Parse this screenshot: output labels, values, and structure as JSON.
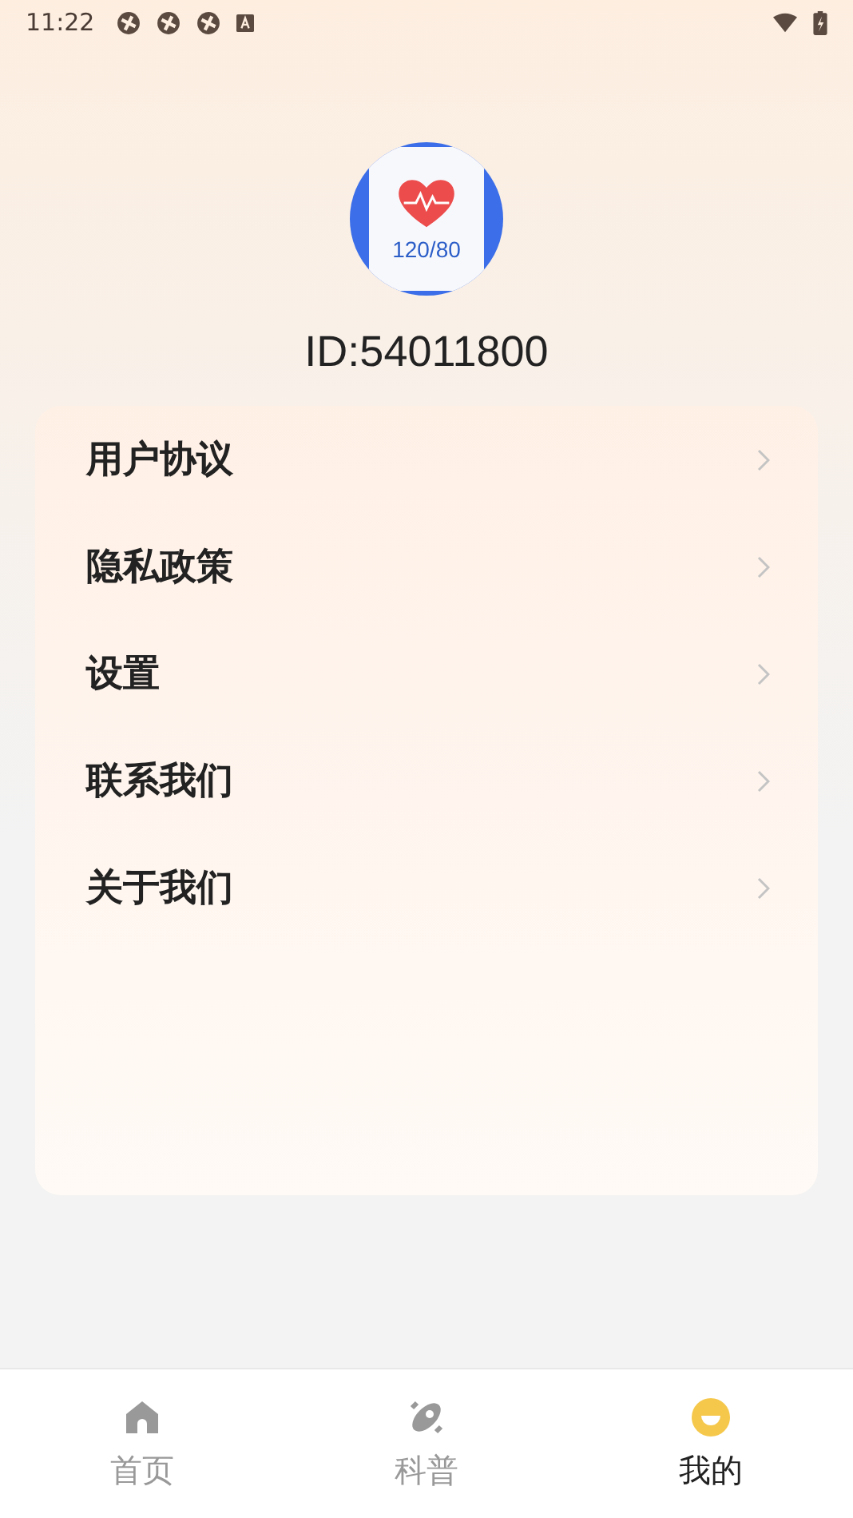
{
  "status_bar": {
    "time": "11:22"
  },
  "profile": {
    "avatar_reading": "120/80",
    "id": "ID:54011800"
  },
  "menu": [
    {
      "label": "用户协议"
    },
    {
      "label": "隐私政策"
    },
    {
      "label": "设置"
    },
    {
      "label": "联系我们"
    },
    {
      "label": "关于我们"
    }
  ],
  "tabs": [
    {
      "label": "首页",
      "kind": "home",
      "selected": false
    },
    {
      "label": "科普",
      "kind": "planet",
      "selected": false
    },
    {
      "label": "我的",
      "kind": "me",
      "selected": true
    }
  ]
}
